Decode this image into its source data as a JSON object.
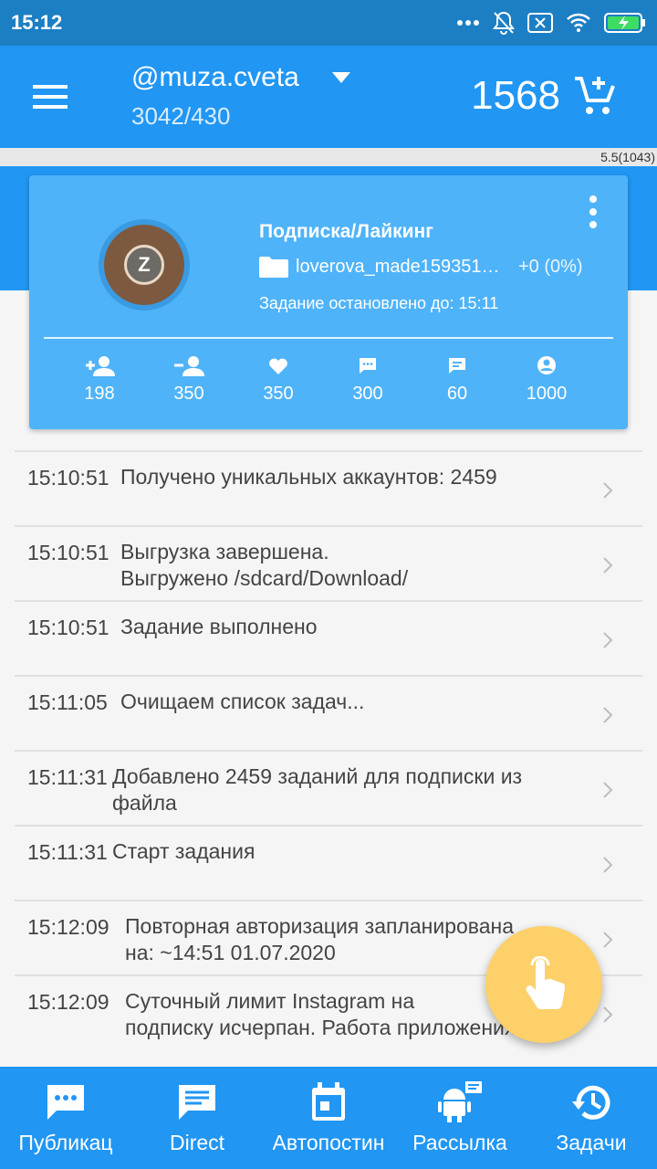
{
  "status_bar": {
    "time": "15:12",
    "icons": [
      "more-dots-icon",
      "bell-off-icon",
      "sim-x-icon",
      "wifi-icon",
      "battery-charging-icon"
    ]
  },
  "toolbar": {
    "account_name": "@muza.cveta",
    "account_stats": "3042/430",
    "balance": "1568",
    "version": "5.5(1043)"
  },
  "card": {
    "title": "Подписка/Лайкинг",
    "file_name": "loverova_made159351…",
    "file_delta": "+0 (0%)",
    "status": "Задание остановлено до: 15:11",
    "avatar_letter": "Z",
    "stats": [
      {
        "icon": "follow-icon",
        "value": "198"
      },
      {
        "icon": "unfollow-icon",
        "value": "350"
      },
      {
        "icon": "like-icon",
        "value": "350"
      },
      {
        "icon": "comment-icon",
        "value": "300"
      },
      {
        "icon": "message-icon",
        "value": "60"
      },
      {
        "icon": "profile-icon",
        "value": "1000"
      }
    ]
  },
  "log": [
    {
      "time": "15:10:51",
      "text1": "Получено уникальных аккаунтов: 2459",
      "text2": ""
    },
    {
      "time": "15:10:51",
      "text1": "Выгрузка завершена.",
      "text2": "Выгружено /sdcard/Download/"
    },
    {
      "time": "15:10:51",
      "text1": "Задание выполнено",
      "text2": ""
    },
    {
      "time": "15:11:05",
      "text1": "Очищаем список задач...",
      "text2": ""
    },
    {
      "time": "15:11:31",
      "text1": "Добавлено 2459 заданий для подписки из",
      "text2": "файла"
    },
    {
      "time": "15:11:31",
      "text1": "Старт задания",
      "text2": ""
    },
    {
      "time": "15:12:09",
      "text1": "Повторная авторизация запланирована",
      "text2": "на: ~14:51 01.07.2020"
    },
    {
      "time": "15:12:09",
      "text1": "Суточный лимит Instagram на",
      "text2": "подписку исчерпан. Работа приложения"
    }
  ],
  "bottom_nav": [
    {
      "icon": "chat-dots-icon",
      "label": "Публикац"
    },
    {
      "icon": "direct-message-icon",
      "label": "Direct"
    },
    {
      "icon": "calendar-icon",
      "label": "Автопостин"
    },
    {
      "icon": "android-broadcast-icon",
      "label": "Рассылка"
    },
    {
      "icon": "history-icon",
      "label": "Задачи"
    }
  ],
  "colors": {
    "primary": "#2196f3",
    "status_bar": "#1c7fc4",
    "card": "#4fb3f9",
    "fab": "#fdd06a"
  }
}
